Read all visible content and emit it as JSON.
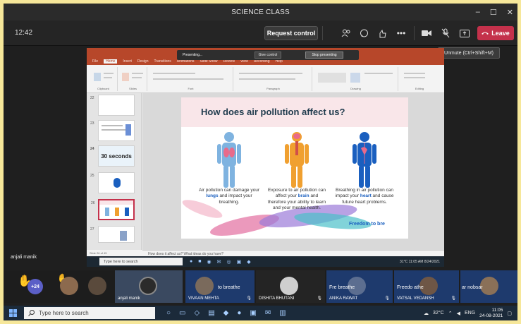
{
  "window": {
    "title": "SCIENCE CLASS",
    "minimize": "–",
    "maximize": "☐",
    "close": "✕"
  },
  "meeting": {
    "clock": "12:42",
    "request_control": "Request control",
    "leave_label": "Leave",
    "leave_color": "#c4314b",
    "tooltip": "Unmute (Ctrl+Shift+M)",
    "icons": [
      "participants-icon",
      "chat-icon",
      "reactions-icon",
      "more-icon",
      "camera-icon",
      "mic-muted-icon",
      "share-icon",
      "phone-icon"
    ]
  },
  "shared_screen": {
    "presenting": "Presenting...",
    "give_control": "Give control",
    "stop_presenting": "Stop presenting",
    "ribbon_tabs": [
      "File",
      "Home",
      "Insert",
      "Design",
      "Transitions",
      "Animations",
      "Slide Show",
      "Review",
      "View",
      "Recording",
      "Help"
    ],
    "ribbon_groups": [
      "Clipboard",
      "Slides",
      "Font",
      "Paragraph",
      "Drawing",
      "Editing"
    ],
    "thumbnails": [
      {
        "num": "22",
        "text": ""
      },
      {
        "num": "23",
        "text": ""
      },
      {
        "num": "24",
        "text": "30 seconds"
      },
      {
        "num": "25",
        "text": ""
      },
      {
        "num": "26",
        "text": ""
      },
      {
        "num": "27",
        "text": ""
      }
    ],
    "slide": {
      "title": "How does air pollution affect us?",
      "captions": [
        {
          "pre": "Air pollution can damage your ",
          "hl": "lungs",
          "post": " and impact your breathing."
        },
        {
          "pre": "Exposure to air pollution can affect your ",
          "hl": "brain",
          "post": " and therefore your ability to learn and your mental health."
        },
        {
          "pre": "Breathing in air pollution can impact your ",
          "hl": "heart",
          "post": " and cause future heart problems."
        }
      ],
      "logo": "Freedom to bre"
    },
    "notes": "How does it affect us? What ideas do you have?",
    "status": "Slide 26 of 45",
    "inner_search": "Type here to search",
    "inner_tray": "31°C  11:05 AM  8/24/2021",
    "presenter": "anjali manik"
  },
  "participants": {
    "more_count": "+24",
    "tiles": [
      {
        "name": "anjali manik",
        "overlay": ""
      },
      {
        "name": "VIVAAN MEHTA",
        "overlay": "to breathe"
      },
      {
        "name": "DISHITA BHUTANI",
        "overlay": ""
      },
      {
        "name": "ANIKA RAWAT",
        "overlay": "Fre     breathe"
      },
      {
        "name": "VATSAL VEDANSH",
        "overlay": "Freedo    athe"
      },
      {
        "name": "",
        "overlay": "ar      nobsar"
      }
    ]
  },
  "taskbar": {
    "search_placeholder": "Type here to search",
    "weather": "32°C",
    "lang": "ENG",
    "time": "11:05",
    "date": "24-08-2021"
  }
}
